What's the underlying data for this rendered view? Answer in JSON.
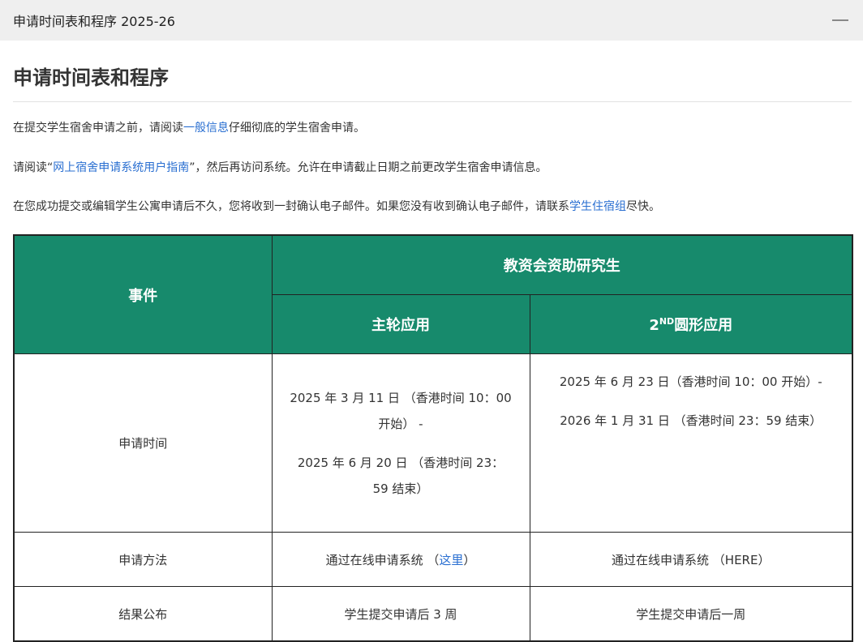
{
  "accordion": {
    "title": "申请时间表和程序 2025-26",
    "toggle_icon": "minus-icon"
  },
  "section": {
    "heading": "申请时间表和程序"
  },
  "paragraphs": {
    "p1_before": "在提交学生宿舍申请之前，请阅读",
    "p1_link": "一般信息",
    "p1_after": "仔细彻底的学生宿舍申请。",
    "p2_before": "请阅读“",
    "p2_link": "网上宿舍申请系统用户指南",
    "p2_after": "”，然后再访问系统。允许在申请截止日期之前更改学生宿舍申请信息。",
    "p3_before": "在您成功提交或编辑学生公寓申请后不久，您将收到一封确认电子邮件。如果您没有收到确认电子邮件，请联系",
    "p3_link": "学生住宿组",
    "p3_after": "尽快。"
  },
  "table": {
    "col_event": "事件",
    "group_header": "教资会资助研究生",
    "col_main": "主轮应用",
    "col_second_prefix": "2",
    "col_second_sup": "ND",
    "col_second_suffix": "圆形应用",
    "rows": {
      "time_label": "申请时间",
      "time_main_line1": "2025 年 3 月 11 日 （香港时间 10：00",
      "time_main_line2": "开始） -",
      "time_main_line3": "2025 年 6 月 20 日 （香港时间 23：",
      "time_main_line4": "59 结束）",
      "time_second_line1": "2025 年 6 月 23 日（香港时间 10：00 开始）-",
      "time_second_line2": "2026 年 1 月 31 日 （香港时间 23：59 结束）",
      "method_label": "申请方法",
      "method_main_before": "通过在线申请系统 （",
      "method_main_link": "这里",
      "method_main_after": "）",
      "method_second": "通过在线申请系统 （HERE）",
      "result_label": "结果公布",
      "result_main": "学生提交申请后 3 周",
      "result_second": "学生提交申请后一周"
    }
  },
  "colors": {
    "header_green": "#178a6c",
    "link_blue": "#2a6fd1"
  }
}
